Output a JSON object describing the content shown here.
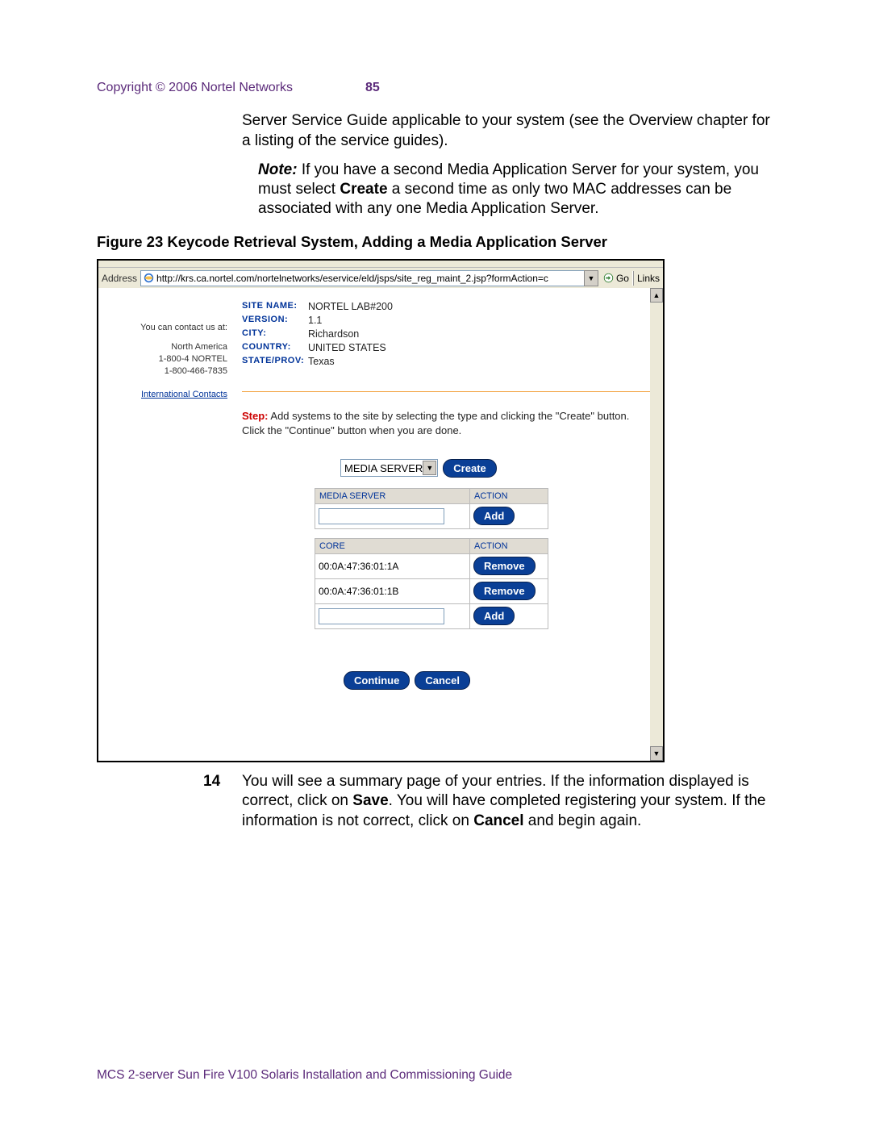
{
  "header": {
    "copyright": "Copyright © 2006 Nortel Networks",
    "page_number": "85"
  },
  "body": {
    "intro": "Server Service Guide applicable to your system (see the Overview chapter for a listing of the service guides).",
    "note_label": "Note:",
    "note_text": "If you have a second Media Application Server for your system, you must select ",
    "note_bold": "Create",
    "note_after": " a second time as only two MAC addresses can be associated with any one Media Application Server."
  },
  "figure_caption": "Figure 23  Keycode Retrieval System, Adding a Media Application Server",
  "addressbar": {
    "label": "Address",
    "url": "http://krs.ca.nortel.com/nortelnetworks/eservice/eld/jsps/site_reg_maint_2.jsp?formAction=c",
    "go": "Go",
    "links": "Links"
  },
  "contact": {
    "heading": "You can contact us at:",
    "line1": "North America",
    "line2": "1-800-4 NORTEL",
    "line3": "1-800-466-7835",
    "intl": "International Contacts"
  },
  "site": {
    "labels": {
      "name": "SITE NAME:",
      "version": "VERSION:",
      "city": "CITY:",
      "country": "COUNTRY:",
      "state": "STATE/PROV:"
    },
    "values": {
      "name": "NORTEL LAB#200",
      "version": "1.1",
      "city": "Richardson",
      "country": "UNITED STATES",
      "state": "Texas"
    }
  },
  "step": {
    "label": "Step:",
    "text": "Add systems to the site by selecting the type and clicking the \"Create\" button. Click the \"Continue\" button when you are done."
  },
  "select_value": "MEDIA SERVER",
  "buttons": {
    "create": "Create",
    "add": "Add",
    "remove": "Remove",
    "continue": "Continue",
    "cancel": "Cancel"
  },
  "tables": {
    "mediaserver": {
      "col1": "MEDIA SERVER",
      "col2": "ACTION"
    },
    "core": {
      "col1": "CORE",
      "col2": "ACTION",
      "rows": [
        "00:0A:47:36:01:1A",
        "00:0A:47:36:01:1B"
      ]
    }
  },
  "step14": {
    "num": "14",
    "before": "You will see a summary page of your entries. If the information displayed is correct, click on ",
    "bold1": "Save",
    "mid": ". You will have completed registering your system. If the information is not correct, click on ",
    "bold2": "Cancel",
    "after": " and begin again."
  },
  "footer": "MCS 2-server Sun Fire V100 Solaris Installation and Commissioning Guide"
}
